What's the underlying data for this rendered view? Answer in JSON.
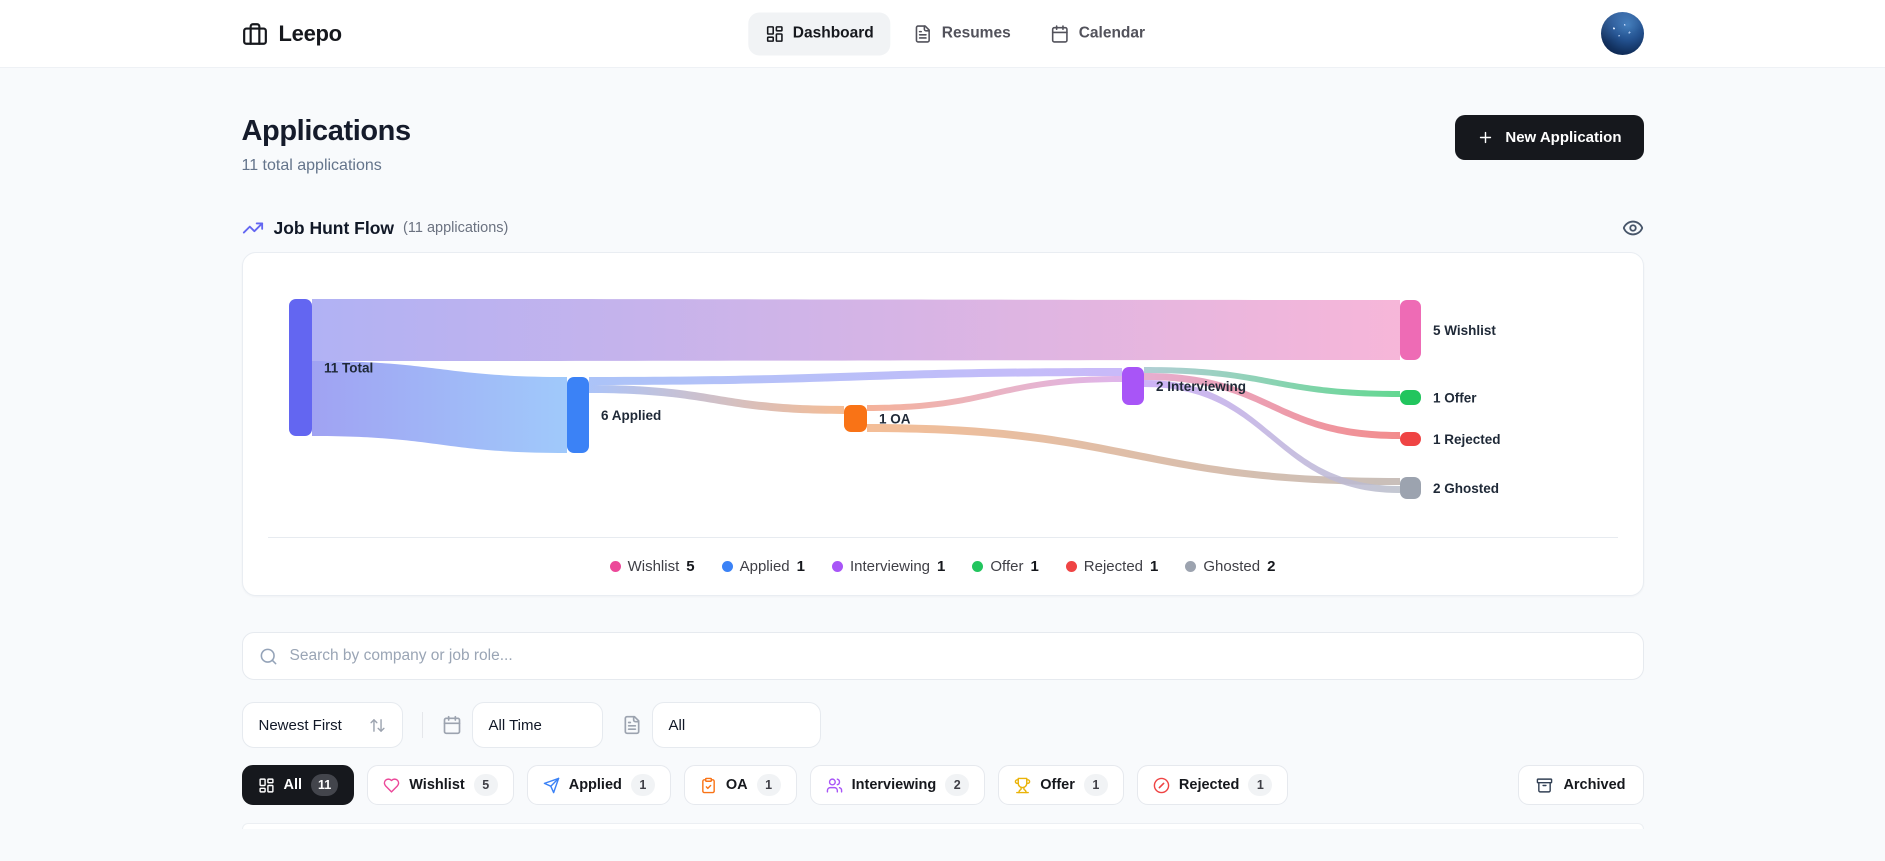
{
  "brand": {
    "name": "Leepo"
  },
  "nav": {
    "tabs": [
      {
        "id": "dashboard",
        "label": "Dashboard",
        "active": true
      },
      {
        "id": "resumes",
        "label": "Resumes",
        "active": false
      },
      {
        "id": "calendar",
        "label": "Calendar",
        "active": false
      }
    ]
  },
  "header": {
    "title": "Applications",
    "subtitle": "11 total applications",
    "new_button_label": "New Application"
  },
  "flow_section": {
    "title": "Job Hunt Flow",
    "subtitle": "(11 applications)"
  },
  "chart_data": {
    "type": "sankey",
    "title": "Job Hunt Flow",
    "total_applications": 11,
    "nodes": [
      {
        "id": "total",
        "label": "11 Total",
        "value": 11,
        "color": "#6366f1"
      },
      {
        "id": "applied",
        "label": "6 Applied",
        "value": 6,
        "color": "#3b82f6"
      },
      {
        "id": "oa",
        "label": "1 OA",
        "value": 1,
        "color": "#f97316"
      },
      {
        "id": "interviewing",
        "label": "2 Interviewing",
        "value": 2,
        "color": "#a855f7"
      },
      {
        "id": "wishlist",
        "label": "5 Wishlist",
        "value": 5,
        "color": "#ee6bb5"
      },
      {
        "id": "offer",
        "label": "1 Offer",
        "value": 1,
        "color": "#22c55e"
      },
      {
        "id": "rejected",
        "label": "1 Rejected",
        "value": 1,
        "color": "#ef4444"
      },
      {
        "id": "ghosted",
        "label": "2 Ghosted",
        "value": 2,
        "color": "#9ca3af"
      }
    ],
    "links": [
      {
        "source": "total",
        "target": "wishlist",
        "value": 5
      },
      {
        "source": "total",
        "target": "applied",
        "value": 6
      },
      {
        "source": "applied",
        "target": "interviewing",
        "value": 1
      },
      {
        "source": "applied",
        "target": "oa",
        "value": 1
      },
      {
        "source": "oa",
        "target": "interviewing",
        "value": 1
      },
      {
        "source": "oa",
        "target": "ghosted",
        "value": 1
      },
      {
        "source": "interviewing",
        "target": "offer",
        "value": 1
      },
      {
        "source": "interviewing",
        "target": "rejected",
        "value": 1
      },
      {
        "source": "interviewing",
        "target": "ghosted",
        "value": 1
      }
    ],
    "legend": [
      {
        "label": "Wishlist",
        "count": 5,
        "color": "#ec4899"
      },
      {
        "label": "Applied",
        "count": 1,
        "color": "#3b82f6"
      },
      {
        "label": "Interviewing",
        "count": 1,
        "color": "#a855f7"
      },
      {
        "label": "Offer",
        "count": 1,
        "color": "#22c55e"
      },
      {
        "label": "Rejected",
        "count": 1,
        "color": "#ef4444"
      },
      {
        "label": "Ghosted",
        "count": 2,
        "color": "#9ca3af"
      }
    ]
  },
  "search": {
    "placeholder": "Search by company or job role..."
  },
  "filters": {
    "sort_value": "Newest First",
    "time_value": "All Time",
    "type_value": "All"
  },
  "chips": [
    {
      "id": "all",
      "label": "All",
      "count": 11,
      "icon": "grid",
      "active": true
    },
    {
      "id": "wishlist",
      "label": "Wishlist",
      "count": 5,
      "icon": "heart",
      "icon_color": "#ec4899"
    },
    {
      "id": "applied",
      "label": "Applied",
      "count": 1,
      "icon": "send",
      "icon_color": "#3b82f6"
    },
    {
      "id": "oa",
      "label": "OA",
      "count": 1,
      "icon": "clipboard-check",
      "icon_color": "#f97316"
    },
    {
      "id": "interviewing",
      "label": "Interviewing",
      "count": 2,
      "icon": "users",
      "icon_color": "#a855f7"
    },
    {
      "id": "offer",
      "label": "Offer",
      "count": 1,
      "icon": "trophy",
      "icon_color": "#eab308"
    },
    {
      "id": "rejected",
      "label": "Rejected",
      "count": 1,
      "icon": "circle-x",
      "icon_color": "#ef4444"
    }
  ],
  "archived": {
    "label": "Archived"
  }
}
